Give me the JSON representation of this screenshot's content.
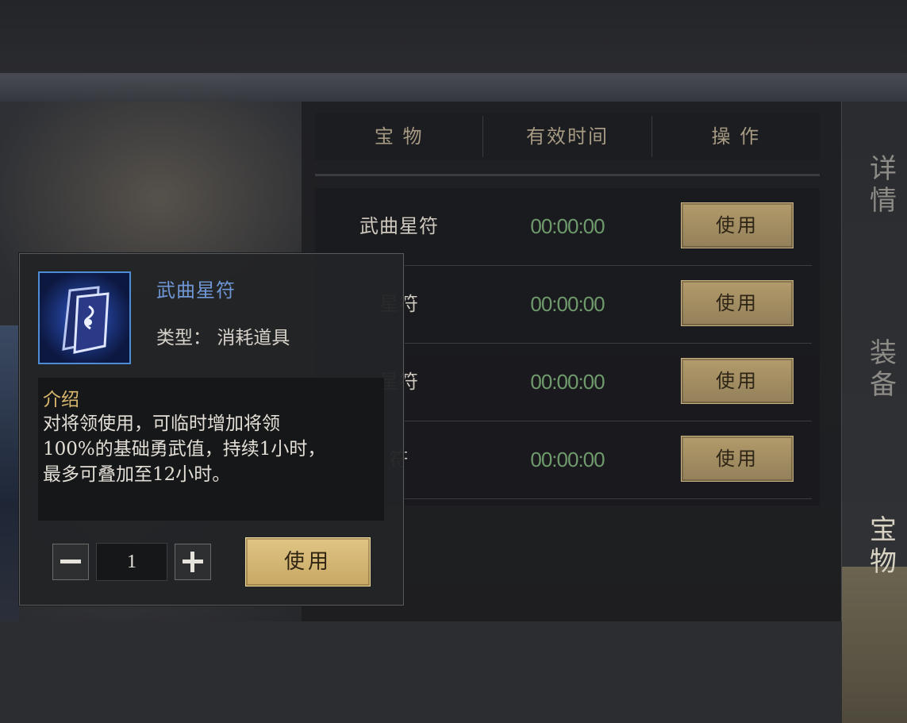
{
  "table": {
    "headers": [
      "宝  物",
      "有效时间",
      "操  作"
    ],
    "rows": [
      {
        "name": "武曲星符",
        "time": "00:00:00",
        "action": "使用"
      },
      {
        "name": "星符",
        "time": "00:00:00",
        "action": "使用"
      },
      {
        "name": "星符",
        "time": "00:00:00",
        "action": "使用"
      },
      {
        "name": "符",
        "time": "00:00:00",
        "action": "使用"
      }
    ]
  },
  "sidenav": {
    "items": [
      {
        "label": "详情"
      },
      {
        "label": "装备"
      },
      {
        "label": "宝物"
      }
    ]
  },
  "tooltip": {
    "icon": "star-talisman-icon",
    "title": "武曲星符",
    "type_label": "类型：",
    "type_value": "消耗道具",
    "desc_title": "介绍",
    "desc_lines": [
      "对将领使用，可临时增加将领",
      "100%的基础勇武值，持续1小时，",
      "最多可叠加至12小时。"
    ],
    "quantity": "1",
    "use_label": "使用"
  },
  "colors": {
    "button_gold": "#b29b6b",
    "time_green": "#6f9a6c",
    "title_blue": "#6f97d6",
    "desc_gold": "#d8b86d"
  }
}
